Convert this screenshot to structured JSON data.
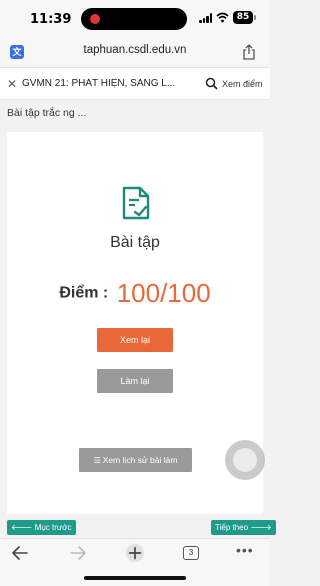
{
  "status_bar": {
    "time": "11:39",
    "battery": "85"
  },
  "browser": {
    "url": "taphuan.csdl.edu.vn"
  },
  "course_header": {
    "title": "GVMN 21: PHÁT HIỆN, SÀNG L...",
    "view_score_label": "Xem điểm"
  },
  "breadcrumb": "Bài tập trắc ng ...",
  "result_card": {
    "title": "Bài tập",
    "score_label": "Điểm :",
    "score_value": "100/100",
    "review_button": "Xem lại",
    "redo_button": "Làm lại",
    "history_button": "Xem lịch sử bài làm"
  },
  "navigation": {
    "prev_label": "Mục trước",
    "next_label": "Tiếp theo"
  },
  "toolbar": {
    "tabs_count": "3"
  },
  "colors": {
    "accent_orange": "#e8683a",
    "nav_teal": "#1f9b8a",
    "doc_icon_teal": "#1f8c7a",
    "button_gray": "#9a9a9a"
  },
  "icons": [
    "translate-icon",
    "share-icon",
    "close-icon",
    "search-icon",
    "document-check-icon",
    "list-icon",
    "arrow-left-icon",
    "arrow-right-icon",
    "back-icon",
    "forward-icon",
    "new-tab-icon",
    "tabs-icon",
    "more-icon"
  ]
}
